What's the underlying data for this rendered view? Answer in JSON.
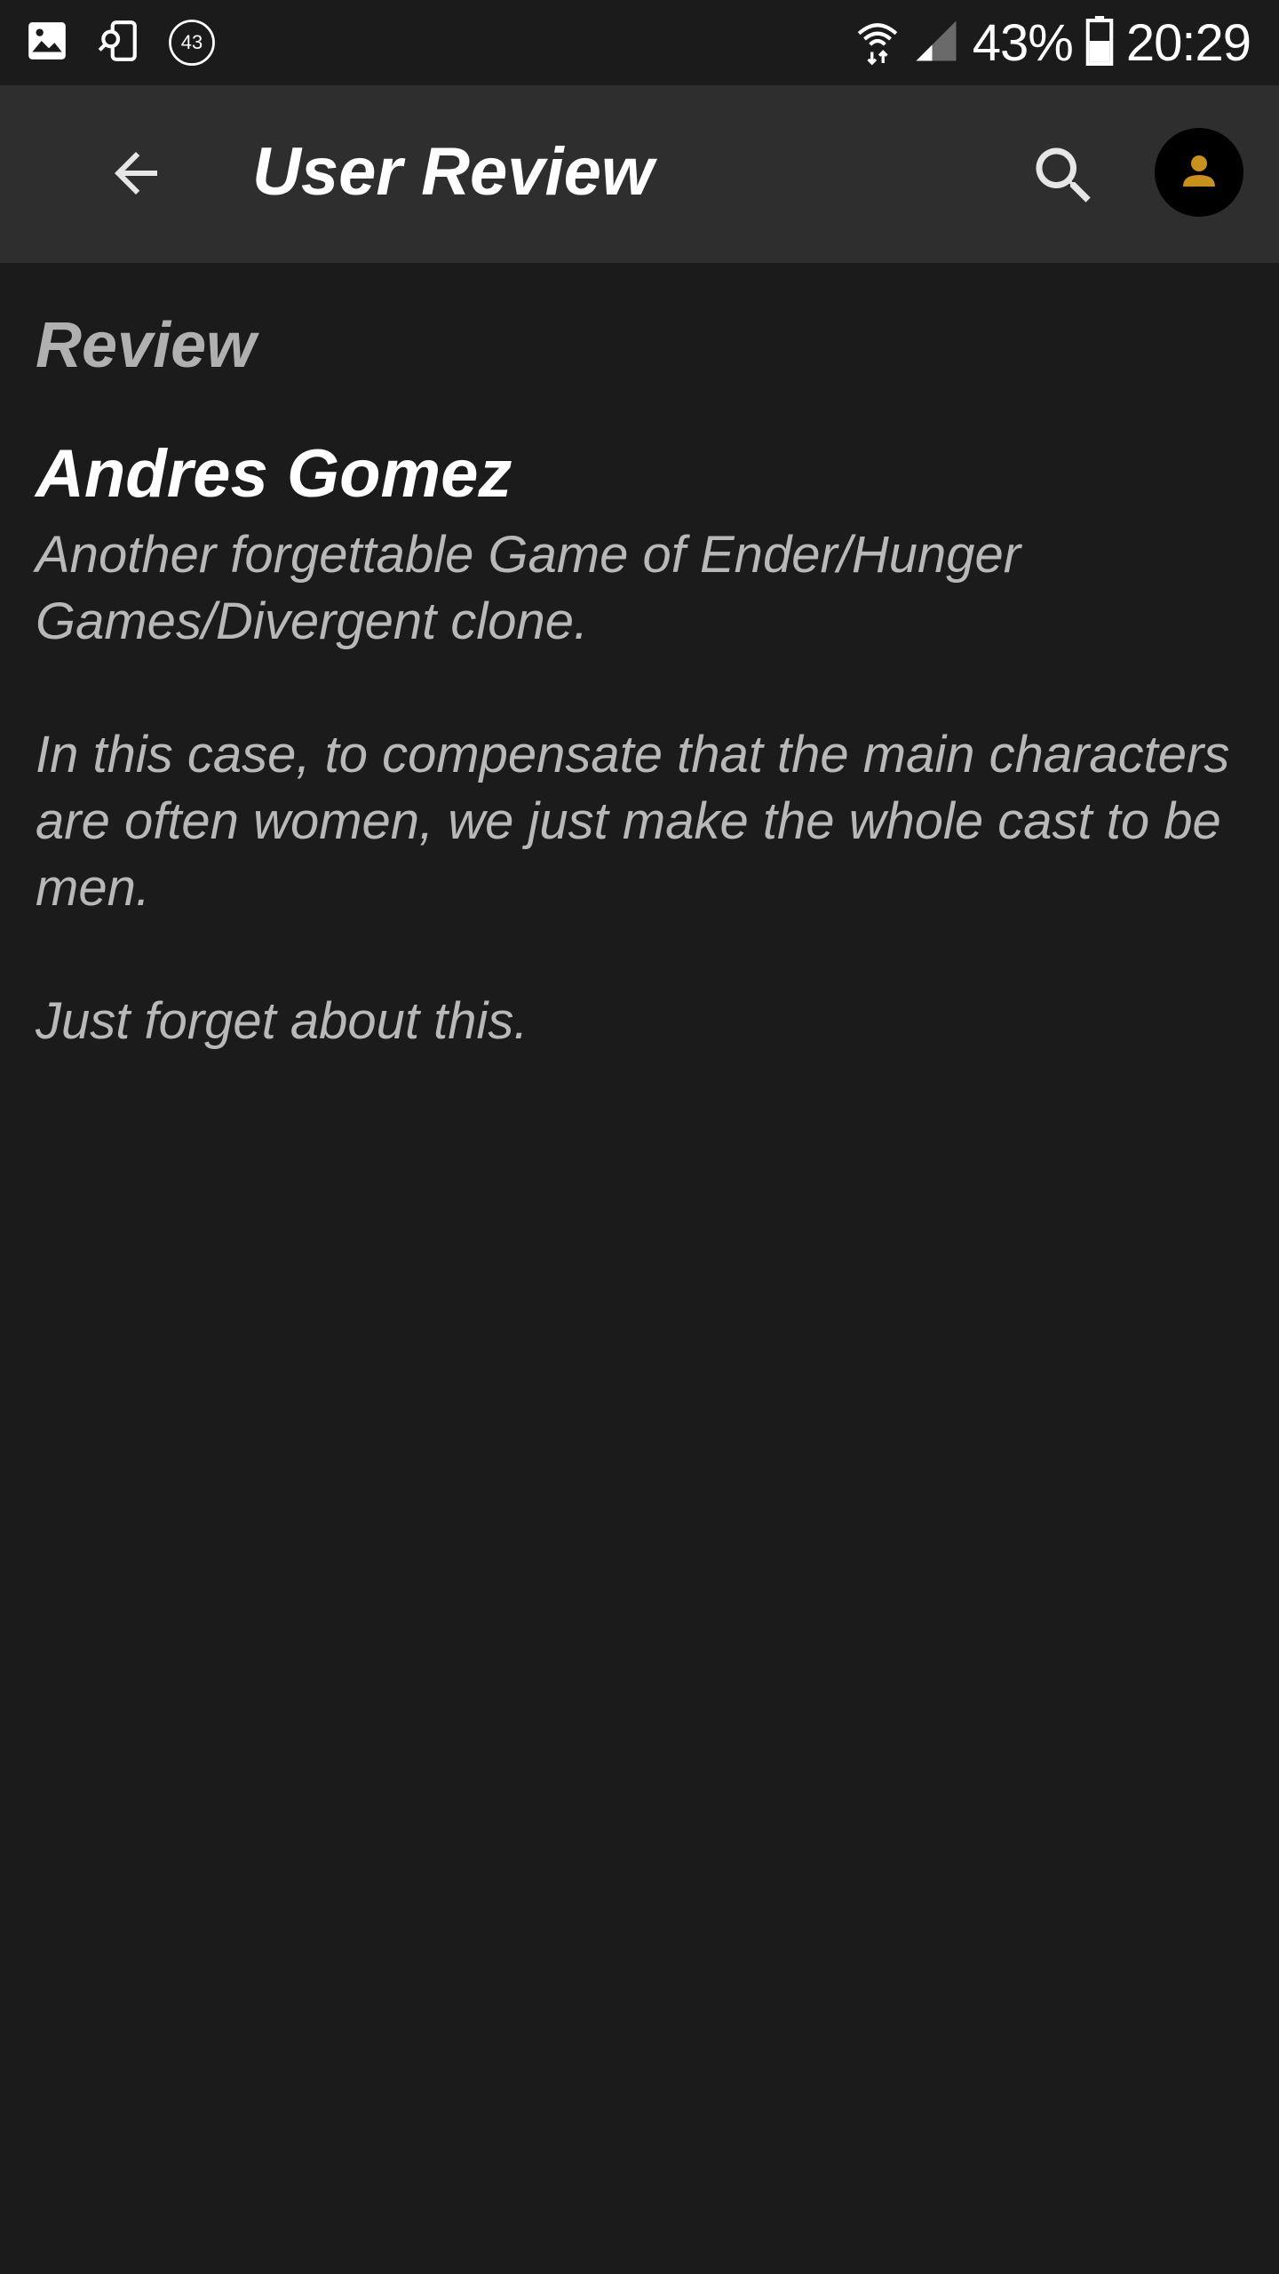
{
  "status_bar": {
    "left_icons": [
      "image-icon",
      "screen-search-icon",
      "notification-count-icon"
    ],
    "notification_count": "43",
    "battery_percent": "43%",
    "time": "20:29"
  },
  "app_bar": {
    "title": "User Review"
  },
  "review": {
    "section_label": "Review",
    "reviewer": "Andres Gomez",
    "paragraphs": [
      "Another forgettable Game of Ender/Hunger Games/Divergent clone.",
      "In this case, to compensate that the main characters are often women, we just make the whole cast to be men.",
      "Just forget about this."
    ]
  },
  "colors": {
    "background": "#1b1b1b",
    "app_bar": "#2e2e2e",
    "avatar_accent": "#c8901e"
  }
}
